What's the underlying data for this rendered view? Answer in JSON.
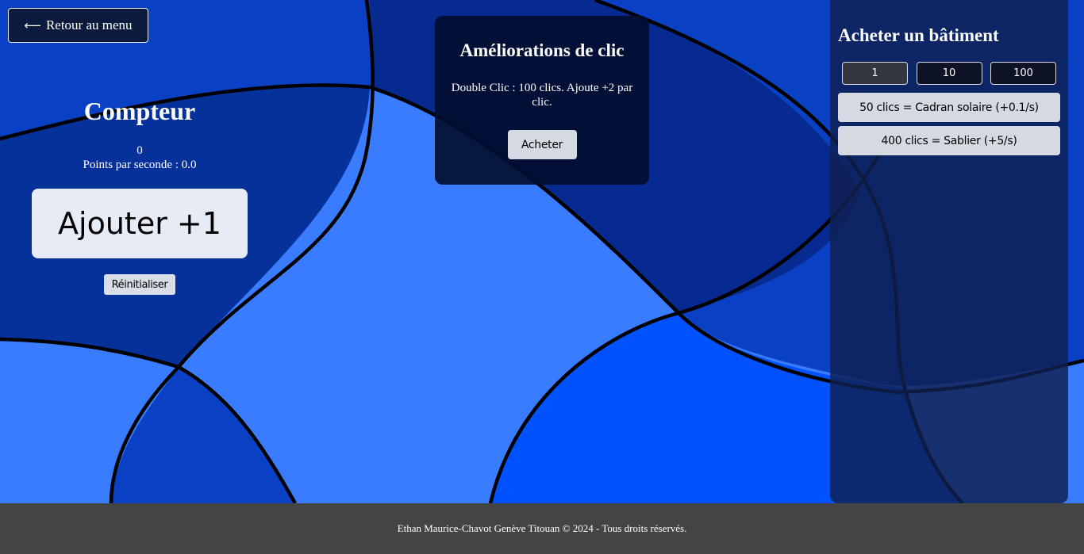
{
  "nav": {
    "back_label": "Retour au menu",
    "back_icon": "arrow-left-icon"
  },
  "counter": {
    "title": "Compteur",
    "value": "0",
    "rate_text": "Points par seconde : 0.0",
    "add_label": "Ajouter +1",
    "reset_label": "Réinitialiser"
  },
  "upgrades": {
    "title": "Améliorations de clic",
    "items": [
      {
        "description": "Double Clic : 100 clics. Ajoute +2 par clic.",
        "buy_label": "Acheter"
      }
    ]
  },
  "buildings": {
    "title": "Acheter un bâtiment",
    "quantities": [
      {
        "label": "1",
        "active": true
      },
      {
        "label": "10",
        "active": false
      },
      {
        "label": "100",
        "active": false
      }
    ],
    "items": [
      {
        "label": "50 clics = Cadran solaire (+0.1/s)"
      },
      {
        "label": "400 clics = Sablier (+5/s)"
      }
    ]
  },
  "footer": {
    "text": "Ethan Maurice-Chavot Genève Titouan © 2024 - Tous droits réservés."
  },
  "colors": {
    "background_light": "#3a7cff",
    "background_dark": "#0a3cb8",
    "background_navy": "#06309a",
    "panel_dark": "#020e30",
    "footer": "#444444",
    "button_light": "#e7ebf6"
  }
}
